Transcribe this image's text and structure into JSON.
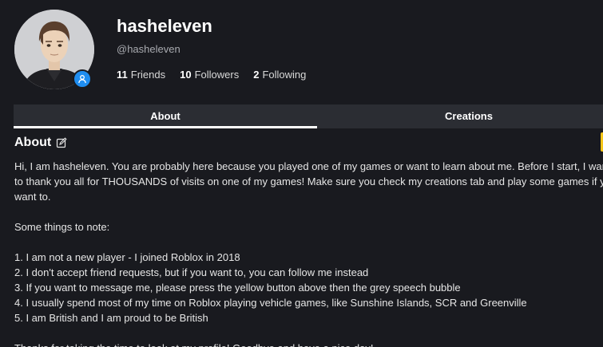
{
  "profile": {
    "display_name": "hasheleven",
    "username": "@hasheleven",
    "stats": [
      {
        "count": "11",
        "label": "Friends"
      },
      {
        "count": "10",
        "label": "Followers"
      },
      {
        "count": "2",
        "label": "Following"
      }
    ],
    "presence_icon": "user-icon",
    "accent_color": "#1f8ef1"
  },
  "tabs": [
    {
      "label": "About",
      "active": true
    },
    {
      "label": "Creations",
      "active": false
    }
  ],
  "about": {
    "title": "About",
    "edit_icon": "edit-icon",
    "intro_lines": [
      "Hi, I am hasheleven. You are probably here because you played one of my games or want to learn about me. Before I start, I wanted",
      "to thank you all for THOUSANDS of visits on one of my games! Make sure you check my creations tab and play some games if you",
      "want to."
    ],
    "note_heading": "Some things to note:",
    "notes": [
      "1. I am not a new player - I joined Roblox in 2018",
      "2. I don't accept friend requests, but if you want to, you can follow me instead",
      "3. If you want to message me, please press the yellow button above then the grey speech bubble",
      "4. I usually spend most of my time on Roblox playing vehicle games, like Sunshine Islands, SCR and Greenville",
      "5. I am British and I am proud to be British"
    ],
    "closing": "Thanks for taking the time to look at my profile! Goodbye and have a nice day!"
  }
}
